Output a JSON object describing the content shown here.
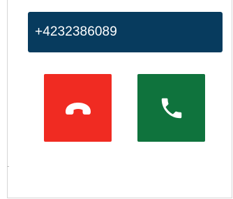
{
  "phone_number": "+4232386089",
  "buttons": {
    "decline": {
      "icon": "hang-up-icon"
    },
    "accept": {
      "icon": "phone-icon"
    }
  },
  "colors": {
    "number_bar": "#073b5e",
    "decline": "#f02b22",
    "accept": "#0f733d",
    "icon": "#ffffff"
  }
}
